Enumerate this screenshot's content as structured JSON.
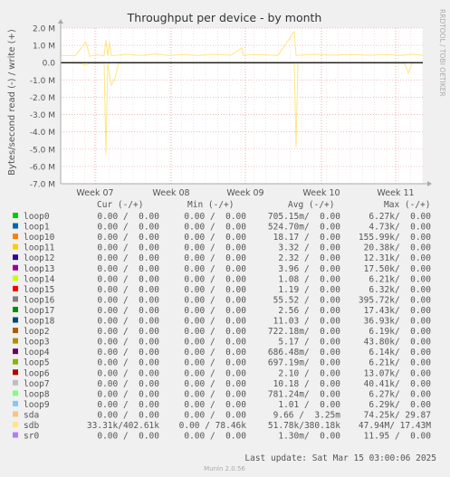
{
  "watermark": "RRDTOOL / TOBI OETIKER",
  "footer": {
    "last_update": "Last update: Sat Mar 15 03:00:06 2025",
    "version": "Munin 2.0.56"
  },
  "legend_header": {
    "cur": "Cur (-/+)",
    "min": "Min (-/+)",
    "avg": "Avg (-/+)",
    "max": "Max (-/+)"
  },
  "legend_rows": [
    {
      "name": "loop0",
      "color": "#00cc00",
      "cur": "0.00 /  0.00",
      "min": "0.00 /  0.00",
      "avg": "705.15m/  0.00",
      "max": "6.27k/  0.00"
    },
    {
      "name": "loop1",
      "color": "#0066b3",
      "cur": "0.00 /  0.00",
      "min": "0.00 /  0.00",
      "avg": "524.70m/  0.00",
      "max": "4.73k/  0.00"
    },
    {
      "name": "loop10",
      "color": "#ff8000",
      "cur": "0.00 /  0.00",
      "min": "0.00 /  0.00",
      "avg": "18.17 /  0.00",
      "max": "155.99k/  0.00"
    },
    {
      "name": "loop11",
      "color": "#ffcc00",
      "cur": "0.00 /  0.00",
      "min": "0.00 /  0.00",
      "avg": "3.32 /  0.00",
      "max": "20.38k/  0.00"
    },
    {
      "name": "loop12",
      "color": "#330099",
      "cur": "0.00 /  0.00",
      "min": "0.00 /  0.00",
      "avg": "2.32 /  0.00",
      "max": "12.31k/  0.00"
    },
    {
      "name": "loop13",
      "color": "#990099",
      "cur": "0.00 /  0.00",
      "min": "0.00 /  0.00",
      "avg": "3.96 /  0.00",
      "max": "17.50k/  0.00"
    },
    {
      "name": "loop14",
      "color": "#ccff00",
      "cur": "0.00 /  0.00",
      "min": "0.00 /  0.00",
      "avg": "1.08 /  0.00",
      "max": "6.21k/  0.00"
    },
    {
      "name": "loop15",
      "color": "#ff0000",
      "cur": "0.00 /  0.00",
      "min": "0.00 /  0.00",
      "avg": "1.19 /  0.00",
      "max": "6.32k/  0.00"
    },
    {
      "name": "loop16",
      "color": "#808080",
      "cur": "0.00 /  0.00",
      "min": "0.00 /  0.00",
      "avg": "55.52 /  0.00",
      "max": "395.72k/  0.00"
    },
    {
      "name": "loop17",
      "color": "#008f00",
      "cur": "0.00 /  0.00",
      "min": "0.00 /  0.00",
      "avg": "2.56 /  0.00",
      "max": "17.43k/  0.00"
    },
    {
      "name": "loop18",
      "color": "#00487d",
      "cur": "0.00 /  0.00",
      "min": "0.00 /  0.00",
      "avg": "11.03 /  0.00",
      "max": "36.93k/  0.00"
    },
    {
      "name": "loop2",
      "color": "#b35a00",
      "cur": "0.00 /  0.00",
      "min": "0.00 /  0.00",
      "avg": "722.18m/  0.00",
      "max": "6.19k/  0.00"
    },
    {
      "name": "loop3",
      "color": "#b38f00",
      "cur": "0.00 /  0.00",
      "min": "0.00 /  0.00",
      "avg": "5.17 /  0.00",
      "max": "43.80k/  0.00"
    },
    {
      "name": "loop4",
      "color": "#6b006b",
      "cur": "0.00 /  0.00",
      "min": "0.00 /  0.00",
      "avg": "686.48m/  0.00",
      "max": "6.14k/  0.00"
    },
    {
      "name": "loop5",
      "color": "#8fb300",
      "cur": "0.00 /  0.00",
      "min": "0.00 /  0.00",
      "avg": "697.19m/  0.00",
      "max": "6.21k/  0.00"
    },
    {
      "name": "loop6",
      "color": "#b30000",
      "cur": "0.00 /  0.00",
      "min": "0.00 /  0.00",
      "avg": "2.10 /  0.00",
      "max": "13.07k/  0.00"
    },
    {
      "name": "loop7",
      "color": "#bebebe",
      "cur": "0.00 /  0.00",
      "min": "0.00 /  0.00",
      "avg": "10.18 /  0.00",
      "max": "40.41k/  0.00"
    },
    {
      "name": "loop8",
      "color": "#80ff80",
      "cur": "0.00 /  0.00",
      "min": "0.00 /  0.00",
      "avg": "781.24m/  0.00",
      "max": "6.27k/  0.00"
    },
    {
      "name": "loop9",
      "color": "#80c9ff",
      "cur": "0.00 /  0.00",
      "min": "0.00 /  0.00",
      "avg": "1.01 /  0.00",
      "max": "6.29k/  0.00"
    },
    {
      "name": "sda",
      "color": "#ffc080",
      "cur": "0.00 /  0.00",
      "min": "0.00 /  0.00",
      "avg": "9.66 /  3.25m",
      "max": "74.25k/ 29.87"
    },
    {
      "name": "sdb",
      "color": "#ffe680",
      "cur": "33.31k/402.61k",
      "min": "0.00 / 78.46k",
      "avg": "51.78k/380.18k",
      "max": "47.94M/ 17.43M"
    },
    {
      "name": "sr0",
      "color": "#aa80ff",
      "cur": "0.00 /  0.00",
      "min": "0.00 /  0.00",
      "avg": "1.30m/  0.00",
      "max": "11.95 /  0.00"
    }
  ],
  "chart_data": {
    "type": "line",
    "title": "Throughput per device - by month",
    "ylabel": "Bytes/second read (-) / write (+)",
    "ylim": [
      -7000000,
      2000000
    ],
    "y_ticks": [
      {
        "value": 2000000,
        "label": "2.0 M"
      },
      {
        "value": 1000000,
        "label": "1.0 M"
      },
      {
        "value": 0,
        "label": "0.0"
      },
      {
        "value": -1000000,
        "label": "-1.0 M"
      },
      {
        "value": -2000000,
        "label": "-2.0 M"
      },
      {
        "value": -3000000,
        "label": "-3.0 M"
      },
      {
        "value": -4000000,
        "label": "-4.0 M"
      },
      {
        "value": -5000000,
        "label": "-5.0 M"
      },
      {
        "value": -6000000,
        "label": "-6.0 M"
      },
      {
        "value": -7000000,
        "label": "-7.0 M"
      }
    ],
    "xlim": [
      0,
      1
    ],
    "x_ticks": [
      {
        "value": 0.095,
        "label": "Week 07"
      },
      {
        "value": 0.305,
        "label": "Week 08"
      },
      {
        "value": 0.51,
        "label": "Week 09"
      },
      {
        "value": 0.72,
        "label": "Week 10"
      },
      {
        "value": 0.925,
        "label": "Week 11"
      }
    ],
    "grid": true,
    "series": [
      {
        "name": "sdb",
        "color": "#ffe680",
        "write": [
          [
            0.0,
            420000
          ],
          [
            0.04,
            400000
          ],
          [
            0.07,
            1200000
          ],
          [
            0.08,
            380000
          ],
          [
            0.1,
            450000
          ],
          [
            0.12,
            400000
          ],
          [
            0.125,
            1300000
          ],
          [
            0.13,
            400000
          ],
          [
            0.135,
            1200000
          ],
          [
            0.14,
            400000
          ],
          [
            0.18,
            480000
          ],
          [
            0.22,
            420000
          ],
          [
            0.26,
            500000
          ],
          [
            0.3,
            420000
          ],
          [
            0.34,
            460000
          ],
          [
            0.38,
            420000
          ],
          [
            0.42,
            480000
          ],
          [
            0.47,
            430000
          ],
          [
            0.5,
            850000
          ],
          [
            0.505,
            430000
          ],
          [
            0.55,
            460000
          ],
          [
            0.6,
            420000
          ],
          [
            0.645,
            1800000
          ],
          [
            0.65,
            420000
          ],
          [
            0.7,
            480000
          ],
          [
            0.75,
            430000
          ],
          [
            0.8,
            470000
          ],
          [
            0.85,
            430000
          ],
          [
            0.9,
            460000
          ],
          [
            0.94,
            420000
          ],
          [
            0.97,
            480000
          ],
          [
            1.0,
            430000
          ]
        ],
        "read": [
          [
            0.0,
            -20000
          ],
          [
            0.05,
            -30000
          ],
          [
            0.07,
            -150000
          ],
          [
            0.08,
            -20000
          ],
          [
            0.12,
            -30000
          ],
          [
            0.125,
            -5300000
          ],
          [
            0.13,
            -30000
          ],
          [
            0.14,
            -1300000
          ],
          [
            0.15,
            -900000
          ],
          [
            0.16,
            -30000
          ],
          [
            0.3,
            -20000
          ],
          [
            0.5,
            -30000
          ],
          [
            0.645,
            -40000
          ],
          [
            0.65,
            -4900000
          ],
          [
            0.655,
            -30000
          ],
          [
            0.8,
            -20000
          ],
          [
            0.95,
            -40000
          ],
          [
            0.96,
            -600000
          ],
          [
            0.97,
            -30000
          ],
          [
            1.0,
            -20000
          ]
        ]
      }
    ]
  }
}
